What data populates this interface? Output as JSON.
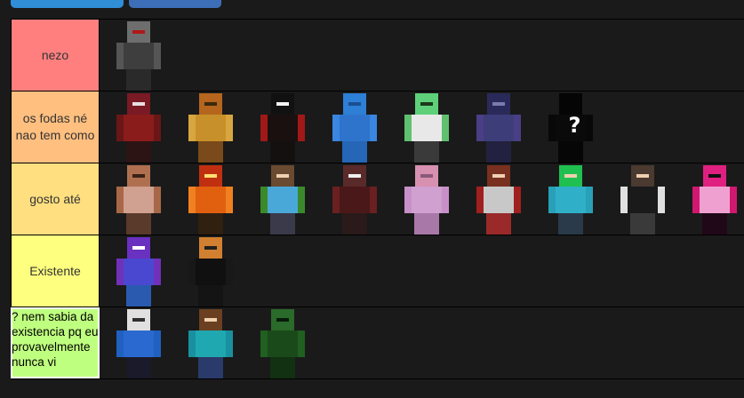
{
  "top_buttons": [
    {
      "color": "#2f8ed6"
    },
    {
      "color": "#3d6fb8"
    }
  ],
  "tiers": [
    {
      "label": "nezo",
      "color": "#ff7f7f",
      "items": [
        {
          "name": "skin-gray-suit-icon",
          "head": "#6e6e6e",
          "body": "#3e3e3e",
          "arms": "#555",
          "legs": "#2a2a2a",
          "face": "#b01818"
        }
      ]
    },
    {
      "label": "os fodas né nao tem como",
      "color": "#ffbf7f",
      "items": [
        {
          "name": "skin-red-hood-icon",
          "head": "#7a1a24",
          "body": "#8b1c1c",
          "arms": "#6a1616",
          "legs": "#2d1414",
          "face": "#e8e0e0"
        },
        {
          "name": "skin-gold-armor-icon",
          "head": "#b5651d",
          "body": "#c8902a",
          "arms": "#d8a640",
          "legs": "#7a4a1a",
          "face": "#3a2a10"
        },
        {
          "name": "skin-black-red-icon",
          "head": "#111",
          "body": "#1a1010",
          "arms": "#a01818",
          "legs": "#141010",
          "face": "#f2f2f2"
        },
        {
          "name": "skin-blue-shark-icon",
          "head": "#2e7fd6",
          "body": "#2f74cc",
          "arms": "#3a86e0",
          "legs": "#2566b6",
          "face": "#1a4f90"
        },
        {
          "name": "skin-green-smile-icon",
          "head": "#5fd07a",
          "body": "#e8e8e8",
          "arms": "#5fc070",
          "legs": "#3a3a3a",
          "face": "#1a3a1a"
        },
        {
          "name": "skin-purple-knight-icon",
          "head": "#2a2a5a",
          "body": "#3d3d7a",
          "arms": "#4a3f86",
          "legs": "#222240",
          "face": "#7a7ab0"
        },
        {
          "name": "skin-black-question-icon",
          "head": "#050505",
          "body": "#0a0a0a",
          "arms": "#080808",
          "legs": "#060606",
          "face": "#050505",
          "mark": "?"
        }
      ]
    },
    {
      "label": "gosto até",
      "color": "#ffdf7f",
      "items": [
        {
          "name": "skin-brown-beard-icon",
          "head": "#b07050",
          "body": "#d0a090",
          "arms": "#a86848",
          "legs": "#5a3a2a",
          "face": "#3a2218"
        },
        {
          "name": "skin-fire-icon",
          "head": "#c03010",
          "body": "#e06010",
          "arms": "#f08020",
          "legs": "#302010",
          "face": "#ffe070"
        },
        {
          "name": "skin-green-jacket-icon",
          "head": "#6a4a30",
          "body": "#4aa8d8",
          "arms": "#3a8a2a",
          "legs": "#3a3a4a",
          "face": "#f0d0b0"
        },
        {
          "name": "skin-dark-red-icon",
          "head": "#5a2a2a",
          "body": "#4a1818",
          "arms": "#6a2020",
          "legs": "#2a1a1a",
          "face": "#f0f0f0"
        },
        {
          "name": "skin-pink-hoodie-icon",
          "head": "#d890b0",
          "body": "#d0a0d0",
          "arms": "#c890c8",
          "legs": "#a878a8",
          "face": "#8a5a7a"
        },
        {
          "name": "skin-red-white-icon",
          "head": "#7a3020",
          "body": "#c8c8c8",
          "arms": "#a02020",
          "legs": "#9a2a2a",
          "face": "#f0d0b0"
        },
        {
          "name": "skin-cyan-green-icon",
          "head": "#20c050",
          "body": "#30b0c8",
          "arms": "#28a0b8",
          "legs": "#2a3a4a",
          "face": "#f0d0b0"
        },
        {
          "name": "skin-black-hood-icon",
          "head": "#4a3a30",
          "body": "#1a1a1a",
          "arms": "#e0e0e0",
          "legs": "#3a3a3a",
          "face": "#f0d0b0"
        },
        {
          "name": "skin-pink-black-icon",
          "head": "#e02080",
          "body": "#f0a0d0",
          "arms": "#d01870",
          "legs": "#200818",
          "face": "#101010"
        }
      ]
    },
    {
      "label": "Existente",
      "color": "#ffff7f",
      "items": [
        {
          "name": "skin-purple-blue-icon",
          "head": "#6a30c0",
          "body": "#4a48d0",
          "arms": "#7030b8",
          "legs": "#2a5ab0",
          "face": "#ffffff"
        },
        {
          "name": "skin-black-suit-icon",
          "head": "#d08030",
          "body": "#101010",
          "arms": "#181818",
          "legs": "#141414",
          "face": "#202020"
        }
      ]
    },
    {
      "label": "? nem sabia da existencia pq eu provavelmente nunca vi",
      "color": "#bfff7f",
      "editing": true,
      "items": [
        {
          "name": "skin-white-hair-icon",
          "head": "#e0e0e0",
          "body": "#2a6ad0",
          "arms": "#2060c0",
          "legs": "#1a1a2a",
          "face": "#303030"
        },
        {
          "name": "skin-teal-shirt-icon",
          "head": "#6a4020",
          "body": "#20a8b0",
          "arms": "#1890a0",
          "legs": "#2a3a6a",
          "face": "#f0d0b0"
        },
        {
          "name": "skin-green-creeper-icon",
          "head": "#2a6a2a",
          "body": "#1a4a1a",
          "arms": "#206020",
          "legs": "#123012",
          "face": "#0a1a0a"
        }
      ]
    }
  ]
}
